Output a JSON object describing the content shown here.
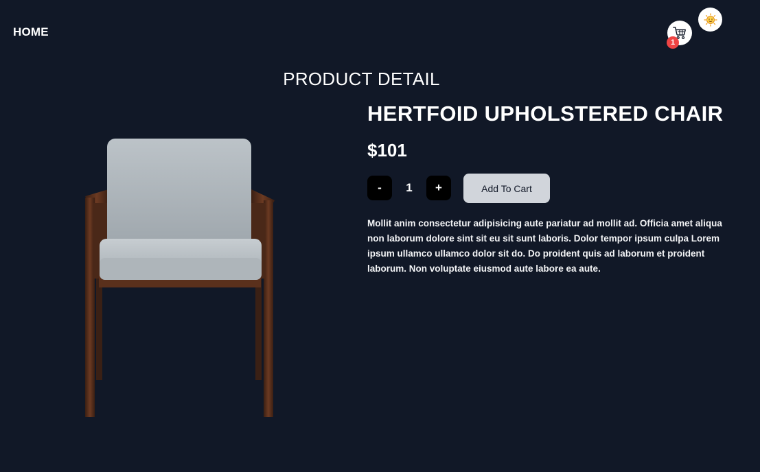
{
  "nav": {
    "home_label": "HOME",
    "cart_count": "1",
    "cart_icon": "shopping-cart-icon",
    "avatar_icon": "smiley-face-icon"
  },
  "page": {
    "title": "PRODUCT DETAIL"
  },
  "product": {
    "name": "HERTFOID UPHOLSTERED CHAIR",
    "price": "$101",
    "quantity": "1",
    "decrement_label": "-",
    "increment_label": "+",
    "add_to_cart_label": "Add To Cart",
    "description": "Mollit anim consectetur adipisicing aute pariatur ad mollit ad. Officia amet aliqua non laborum dolore sint sit eu sit sunt laboris. Dolor tempor ipsum culpa Lorem ipsum ullamco ullamco dolor sit do. Do proident quis ad laborum et proident laborum. Non voluptate eiusmod aute labore ea aute.",
    "image_alt": "upholstered-chair-image"
  },
  "colors": {
    "background": "#111827",
    "button_dark": "#000000",
    "button_light": "#d1d5db",
    "badge": "#ef4444",
    "text": "#ffffff"
  }
}
